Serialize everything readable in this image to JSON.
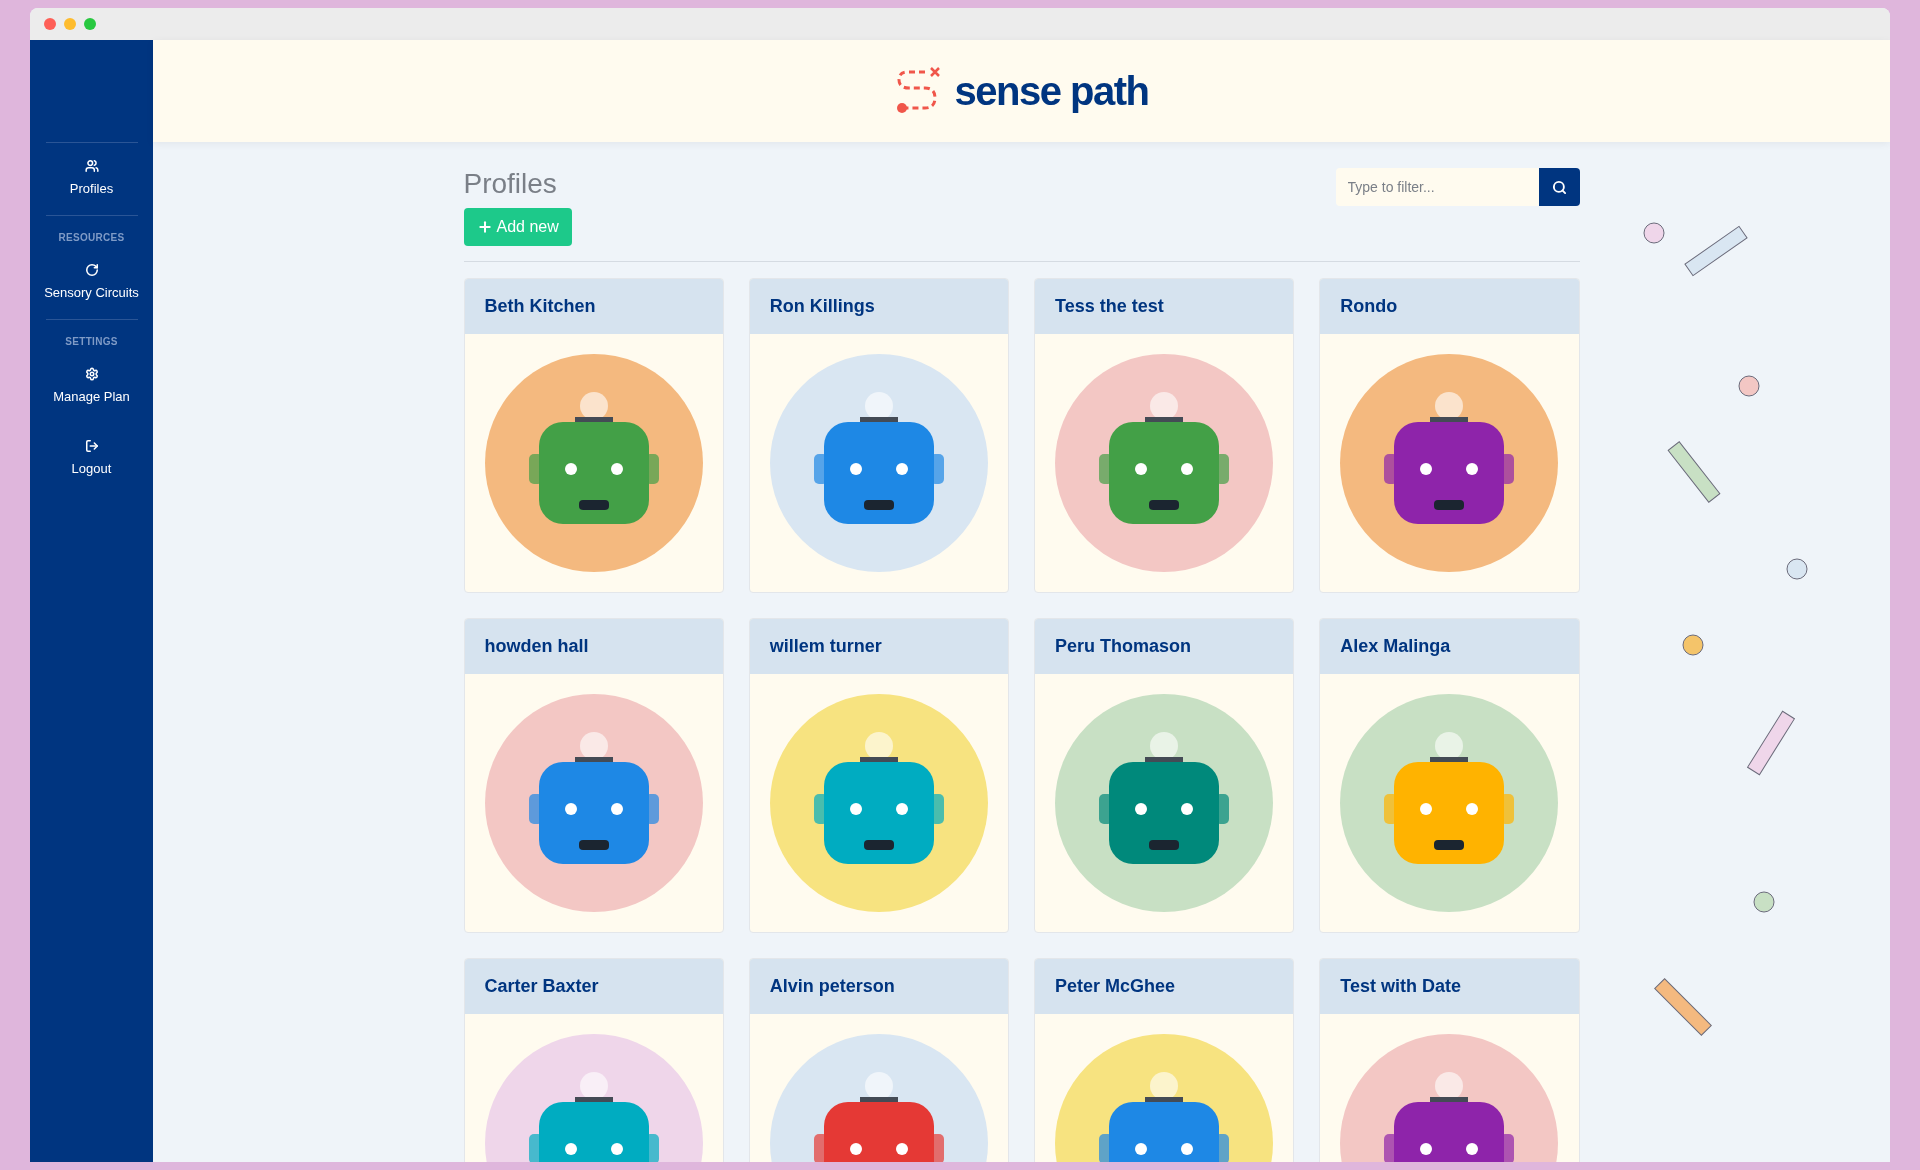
{
  "sidebar": {
    "items": [
      {
        "kind": "link",
        "label": "Profiles"
      },
      {
        "kind": "section",
        "label": "RESOURCES"
      },
      {
        "kind": "link",
        "label": "Sensory Circuits"
      },
      {
        "kind": "section",
        "label": "SETTINGS"
      },
      {
        "kind": "link",
        "label": "Manage Plan"
      },
      {
        "kind": "link",
        "label": "Logout"
      }
    ]
  },
  "header": {
    "logo_text": "sense path"
  },
  "page": {
    "title": "Profiles",
    "add_button": "Add new",
    "filter": {
      "placeholder": "Type to filter..."
    }
  },
  "profiles": [
    {
      "name": "Beth Kitchen",
      "color": "#f4b97f"
    },
    {
      "name": "Ron Killings",
      "color": "#d9e6f2"
    },
    {
      "name": "Tess the test",
      "color": "#f3c7c4"
    },
    {
      "name": "Rondo",
      "color": "#f4b97f"
    },
    {
      "name": "howden hall",
      "color": "#f3c7c4"
    },
    {
      "name": "willem turner",
      "color": "#f7e380"
    },
    {
      "name": "Peru Thomason",
      "color": "#c8e0c4"
    },
    {
      "name": "Alex Malinga",
      "color": "#c8e0c4"
    },
    {
      "name": "Carter Baxter",
      "color": "#efd6ea"
    },
    {
      "name": "Alvin peterson",
      "color": "#d9e6f2"
    },
    {
      "name": "Peter McGhee",
      "color": "#f7e380"
    },
    {
      "name": "Test with Date",
      "color": "#f3c7c4"
    }
  ]
}
